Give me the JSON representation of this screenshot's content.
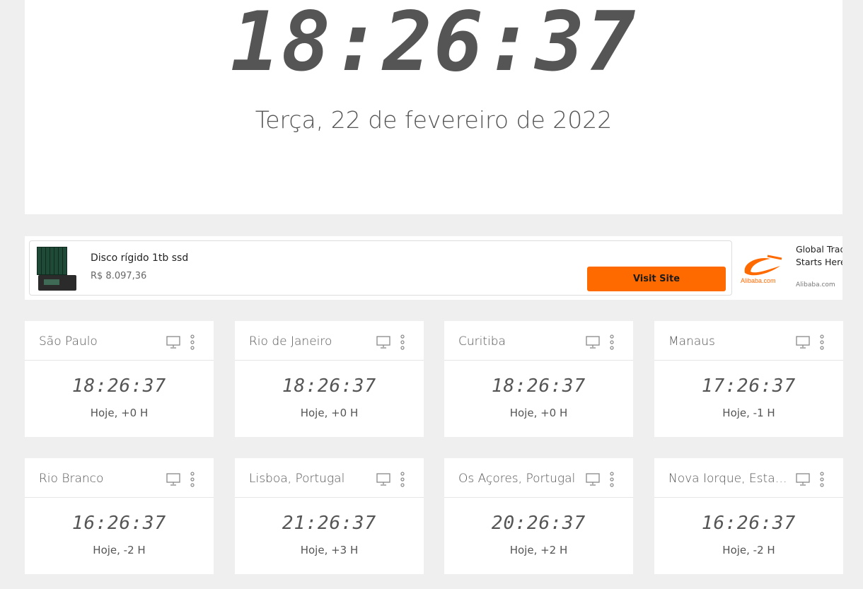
{
  "main": {
    "time": "18:26:37",
    "date": "Terça, 22 de fevereiro de 2022"
  },
  "ad": {
    "product_title": "Disco rígido 1tb ssd",
    "product_price": "R$ 8.097,36",
    "cta_label": "Visit Site",
    "cta_color": "#ff6a00",
    "second_ad_text_line1": "Global Trad",
    "second_ad_text_line2": "Starts Here",
    "second_ad_logo_text": "Alibaba.com",
    "second_ad_domain": "Alibaba.com"
  },
  "cards": [
    {
      "city": "São Paulo",
      "time": "18:26:37",
      "offset": "Hoje, +0 H"
    },
    {
      "city": "Rio de Janeiro",
      "time": "18:26:37",
      "offset": "Hoje, +0 H"
    },
    {
      "city": "Curitiba",
      "time": "18:26:37",
      "offset": "Hoje, +0 H"
    },
    {
      "city": "Manaus",
      "time": "17:26:37",
      "offset": "Hoje, -1 H"
    },
    {
      "city": "Rio Branco",
      "time": "16:26:37",
      "offset": "Hoje, -2 H"
    },
    {
      "city": "Lisboa, Portugal",
      "time": "21:26:37",
      "offset": "Hoje, +3 H"
    },
    {
      "city": "Os Açores, Portugal",
      "time": "20:26:37",
      "offset": "Hoje, +2 H"
    },
    {
      "city": "Nova Iorque, Estados Unidos",
      "time": "16:26:37",
      "offset": "Hoje, -2 H"
    }
  ],
  "icons": {
    "monitor": "monitor-icon",
    "more": "more-vertical-icon"
  },
  "colors": {
    "page_bg": "#efefef",
    "card_bg": "#ffffff",
    "text": "#555555"
  }
}
